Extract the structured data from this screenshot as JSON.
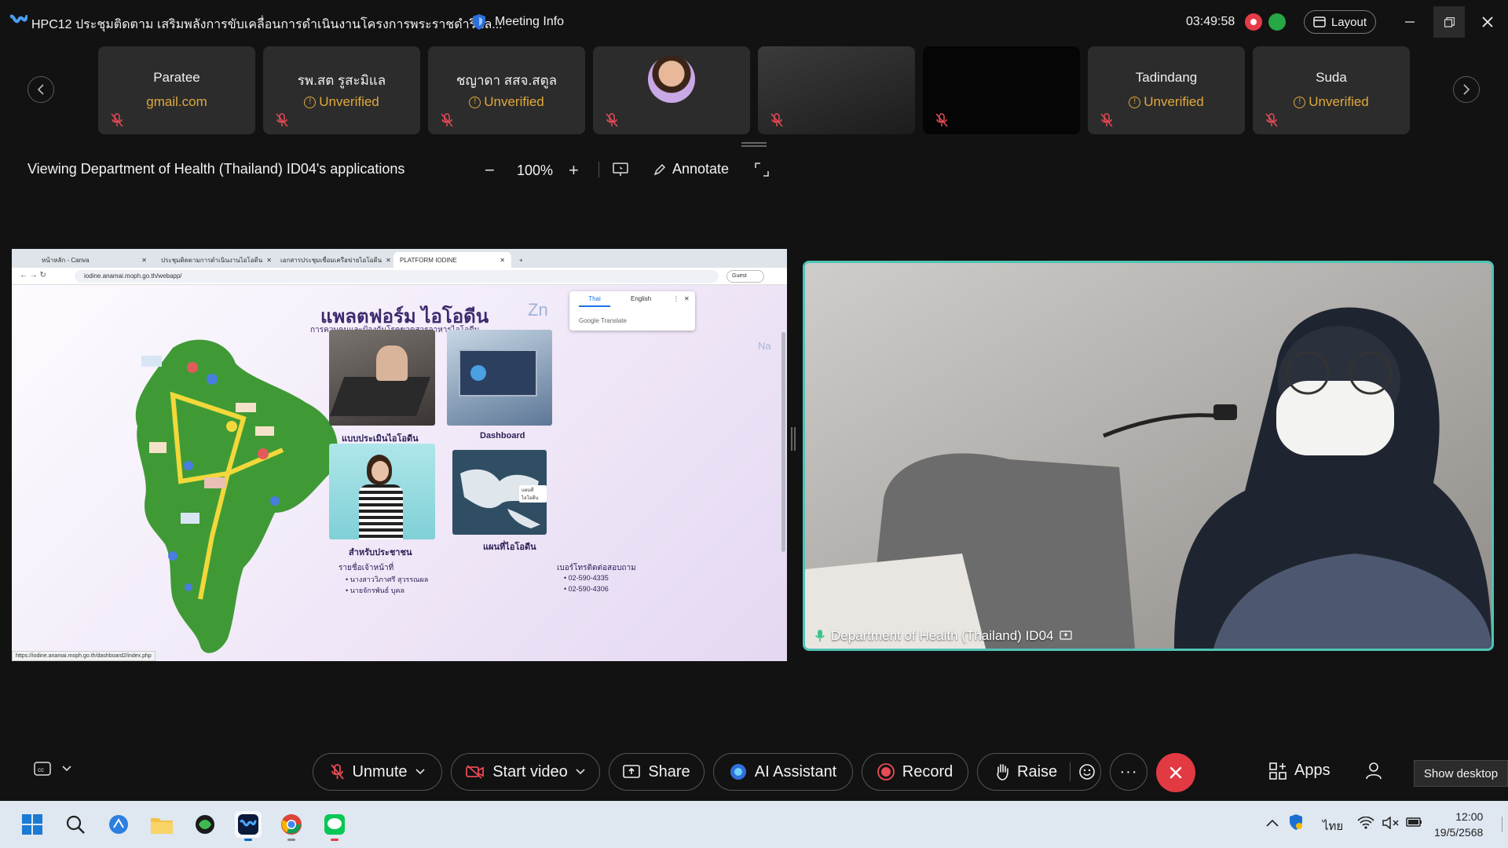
{
  "window": {
    "title": "HPC12 ประชุมติดตาม เสริมพลังการขับเคลื่อนการดำเนินงานโครงการพระราชดำริแล...",
    "meeting_info_label": "Meeting Info",
    "timer": "03:49:58",
    "layout_label": "Layout"
  },
  "participants": [
    {
      "name": "Paratee",
      "sub": "gmail.com",
      "type": "name",
      "sub_color": "#e0a93a"
    },
    {
      "name": "รพ.สต รูสะมิแล",
      "sub": "Unverified",
      "type": "unverified"
    },
    {
      "name": "ชญาดา สสจ.สตูล",
      "sub": "Unverified",
      "type": "unverified"
    },
    {
      "name": "",
      "sub": "",
      "type": "avatar"
    },
    {
      "name": "",
      "sub": "",
      "type": "video-dark"
    },
    {
      "name": "",
      "sub": "",
      "type": "video-black"
    },
    {
      "name": "Tadindang",
      "sub": "Unverified",
      "type": "unverified"
    },
    {
      "name": "Suda",
      "sub": "Unverified",
      "type": "unverified"
    }
  ],
  "share_toolbar": {
    "title": "Viewing Department of Health (Thailand) ID04's applications",
    "zoom": "100%",
    "annotate_label": "Annotate"
  },
  "shared_screen": {
    "tabs": [
      "หน้าหลัก - Canva",
      "ประชุมติดตามการดำเนินงานไอโอดีน",
      "เอกสารประชุมเชื่อมเครือข่ายไอโอดีน",
      "PLATFORM IODINE"
    ],
    "url": "iodine.anamai.moph.go.th/webapp/",
    "guest_label": "Guest",
    "translate": {
      "thai": "Thai",
      "english": "English",
      "footer": "Google Translate"
    },
    "page_title": "แพลตฟอร์ม ไอโอดีน",
    "page_subtitle": "การควบคุมและป้องกันโรคขาดสารอาหารไอโอดีน",
    "zn_text": "Zn",
    "na_text": "Na",
    "cards": [
      {
        "label": "แบบประเมินไอโอดีน"
      },
      {
        "label": "Dashboard"
      },
      {
        "label": "สำหรับประชาชน"
      },
      {
        "label": "แผนที่ไอโอดีน"
      }
    ],
    "map_tooltip": "แผนที่ไอโอดีน",
    "staff_heading": "รายชื่อเจ้าหน้าที่",
    "staff": [
      "นางสาววิภาศรี สุวรรณผล",
      "นายจักรพันธ์ บุคล"
    ],
    "phones_heading": "เบอร์โทรติดต่อสอบถาม",
    "phones": [
      "02-590-4335",
      "02-590-4306"
    ],
    "status_url": "https://iodine.anamai.moph.go.th/dashboard2/index.php"
  },
  "speaker": {
    "label": "Department of Health (Thailand) ID04"
  },
  "controls": {
    "unmute": "Unmute",
    "start_video": "Start video",
    "share": "Share",
    "ai_assistant": "AI Assistant",
    "record": "Record",
    "raise": "Raise",
    "apps": "Apps",
    "show_desktop": "Show desktop"
  },
  "taskbar": {
    "lang": "ไทย",
    "time": "12:00",
    "date": "19/5/2568"
  },
  "colors": {
    "accent_teal": "#4fc4b5",
    "warning": "#e0a93a",
    "end_call": "#e23a43",
    "record_red": "#e63b48",
    "network_green": "#27a844"
  }
}
